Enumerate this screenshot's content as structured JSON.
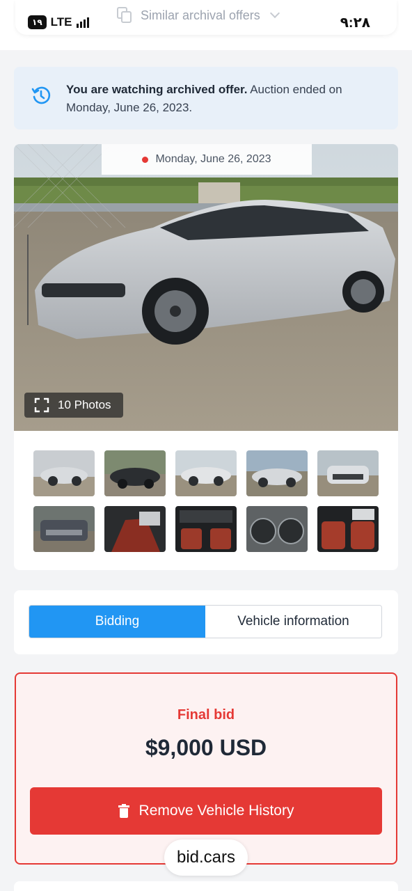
{
  "status_bar": {
    "battery": "۱۹",
    "network": "LTE",
    "time": "۹:۲۸"
  },
  "nav": {
    "similar_label": "Similar archival offers",
    "similar_icon": "copy-icon",
    "chevron_icon": "chevron-down-icon"
  },
  "notice": {
    "icon": "history-icon",
    "bold": "You are watching archived offer.",
    "text": " Auction ended on Monday, June 26, 2023."
  },
  "gallery": {
    "date": "Monday, June 26, 2023",
    "photos_label": "10 Photos",
    "thumb_count": 10
  },
  "tabs": [
    {
      "label": "Bidding",
      "active": true
    },
    {
      "label": "Vehicle information",
      "active": false
    }
  ],
  "bid": {
    "label": "Final bid",
    "amount": "$9,000 USD",
    "button_label": "Remove Vehicle History",
    "button_icon": "trash-icon"
  },
  "brand": "bid.cars",
  "colors": {
    "accent_blue": "#2196f3",
    "accent_red": "#e53935",
    "notice_bg": "#e8f0f9"
  }
}
